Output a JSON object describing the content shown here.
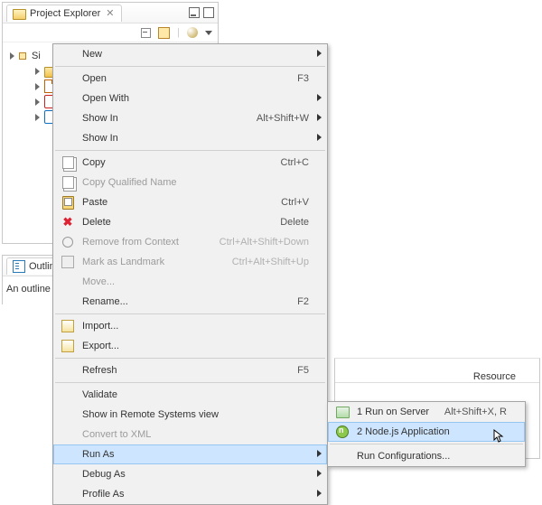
{
  "project_explorer": {
    "title": "Project Explorer",
    "toolbar": {
      "collapse_tip": "Collapse All",
      "link_tip": "Link with Editor"
    },
    "tree": {
      "root_prefix": "Si",
      "items": [
        {
          "icon": "i-folder",
          "indent": 18
        },
        {
          "icon": "i-jsfile",
          "indent": 18
        },
        {
          "icon": "i-launch",
          "indent": 18
        },
        {
          "icon": "i-blue",
          "indent": 18
        }
      ]
    }
  },
  "outline": {
    "title": "Outline",
    "body": "An outline is"
  },
  "problems": {
    "column": "Resource"
  },
  "menu": [
    {
      "type": "item",
      "label": "New",
      "submenu": true
    },
    {
      "type": "sep"
    },
    {
      "type": "item",
      "label": "Open",
      "accel": "F3"
    },
    {
      "type": "item",
      "label": "Open With",
      "submenu": true
    },
    {
      "type": "item",
      "label": "Show In",
      "accel": "Alt+Shift+W",
      "submenu": true
    },
    {
      "type": "item",
      "label": "Show In",
      "submenu": true
    },
    {
      "type": "sep"
    },
    {
      "type": "item",
      "label": "Copy",
      "accel": "Ctrl+C",
      "icon": "i-copy"
    },
    {
      "type": "item",
      "label": "Copy Qualified Name",
      "icon": "i-copy",
      "disabled": true
    },
    {
      "type": "item",
      "label": "Paste",
      "accel": "Ctrl+V",
      "icon": "i-paste"
    },
    {
      "type": "item",
      "label": "Delete",
      "accel": "Delete",
      "icon": "i-delete",
      "iconText": "✖"
    },
    {
      "type": "item",
      "label": "Remove from Context",
      "accel": "Ctrl+Alt+Shift+Down",
      "disabled": true,
      "icon": "i-link"
    },
    {
      "type": "item",
      "label": "Mark as Landmark",
      "accel": "Ctrl+Alt+Shift+Up",
      "disabled": true,
      "icon": "i-landmark"
    },
    {
      "type": "item",
      "label": "Move...",
      "disabled": true
    },
    {
      "type": "item",
      "label": "Rename...",
      "accel": "F2"
    },
    {
      "type": "sep"
    },
    {
      "type": "item",
      "label": "Import...",
      "icon": "i-import"
    },
    {
      "type": "item",
      "label": "Export...",
      "icon": "i-import"
    },
    {
      "type": "sep"
    },
    {
      "type": "item",
      "label": "Refresh",
      "accel": "F5"
    },
    {
      "type": "sep"
    },
    {
      "type": "item",
      "label": "Validate"
    },
    {
      "type": "item",
      "label": "Show in Remote Systems view"
    },
    {
      "type": "item",
      "label": "Convert to XML",
      "disabled": true
    },
    {
      "type": "item",
      "label": "Run As",
      "submenu": true,
      "hover": true
    },
    {
      "type": "item",
      "label": "Debug As",
      "submenu": true
    },
    {
      "type": "item",
      "label": "Profile As",
      "submenu": true
    }
  ],
  "submenu": {
    "items": [
      {
        "label": "1 Run on Server",
        "accel": "Alt+Shift+X, R",
        "icon": "i-server"
      },
      {
        "label": "2 Node.js Application",
        "icon": "i-node",
        "hover": true
      }
    ],
    "footer": "Run Configurations..."
  }
}
